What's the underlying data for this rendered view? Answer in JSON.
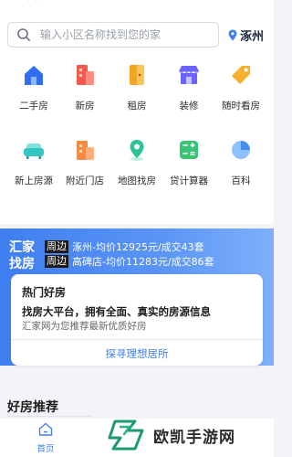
{
  "statusbar": {
    "ghost_text": "· · ·"
  },
  "search": {
    "placeholder": "输入小区名称找到您的家"
  },
  "location": {
    "city": "涿州"
  },
  "categories": [
    {
      "label": "二手房",
      "icon": "house-icon",
      "color": "#2f6ff0"
    },
    {
      "label": "新房",
      "icon": "building-icon",
      "color": "#f2584b"
    },
    {
      "label": "租房",
      "icon": "door-icon",
      "color": "#f4a425"
    },
    {
      "label": "装修",
      "icon": "store-icon",
      "color": "#6c63ff"
    },
    {
      "label": "随时看房",
      "icon": "tag-icon",
      "color": "#f5b12b"
    },
    {
      "label": "新上房源",
      "icon": "sofa-icon",
      "color": "#33c6c3"
    },
    {
      "label": "附近门店",
      "icon": "shop-icon",
      "color": "#f58a42"
    },
    {
      "label": "地图找房",
      "icon": "map-pin-icon",
      "color": "#2cc39a"
    },
    {
      "label": "贷计算器",
      "icon": "calculator-icon",
      "color": "#39c477"
    },
    {
      "label": "百科",
      "icon": "pie-chart-icon",
      "color": "#3f8ef0"
    }
  ],
  "promo": {
    "brand": "汇家找房",
    "rows": [
      {
        "tag": "周边",
        "text": "涿州-均价12925元/成交43套"
      },
      {
        "tag": "周边",
        "text": "高碑店-均价11283元/成交86套"
      }
    ]
  },
  "card": {
    "heading": "热门好房",
    "title": "找房大平台，拥有全面、真实的房源信息",
    "subtitle": "汇家网为您推荐最新优质好房",
    "cta": "探寻理想居所"
  },
  "section": {
    "title": "好房推荐"
  },
  "tabbar": {
    "home_label": "首页"
  },
  "watermark": {
    "text": "欧凯手游网"
  },
  "colors": {
    "accent": "#3f7ef0",
    "background": "#f2f4f7"
  }
}
